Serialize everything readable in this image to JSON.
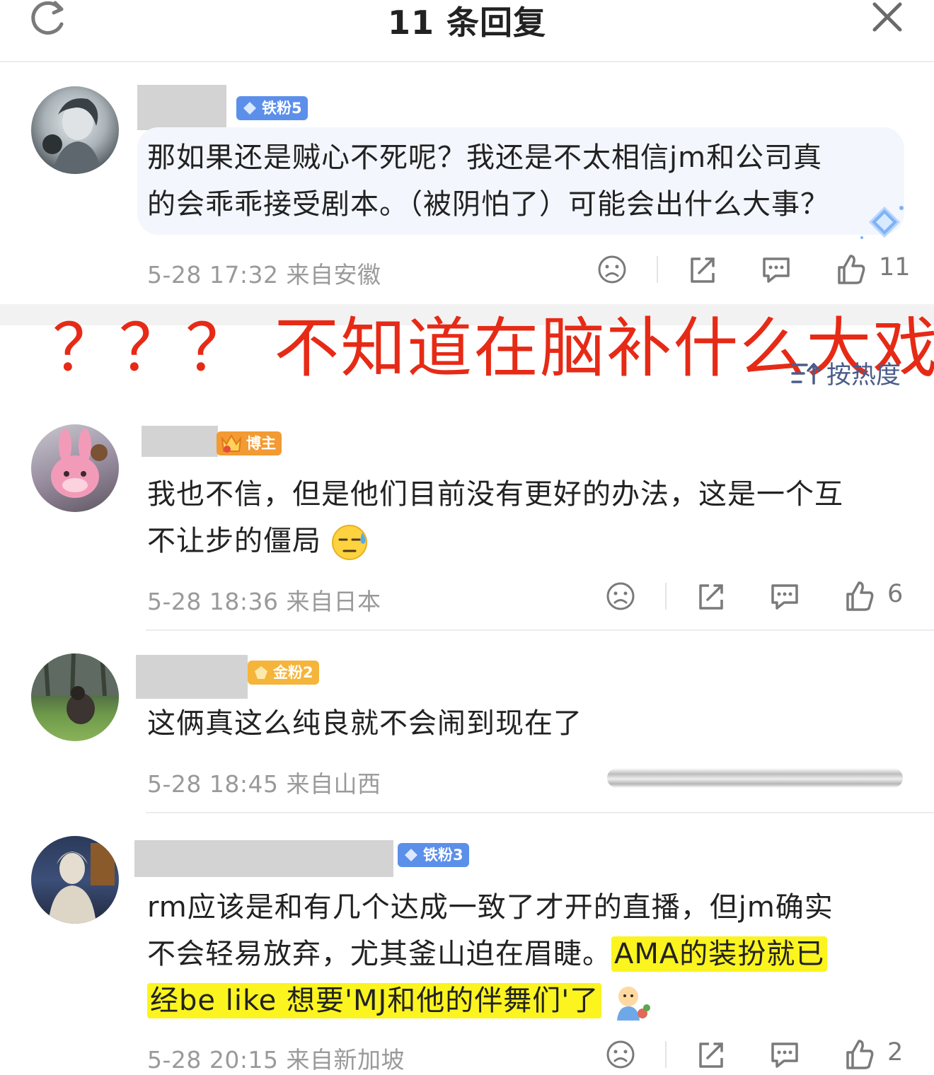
{
  "header": {
    "title": "11 条回复"
  },
  "overlay": {
    "annotation": "？？？ 不知道在脑补什么大戏"
  },
  "sort": {
    "label": "按热度"
  },
  "comments": [
    {
      "badge": "铁粉5",
      "text_line1": "那如果还是贼心不死呢？我还是不太相信jm和公司真",
      "text_line2": "的会乖乖接受剧本。（被阴怕了）可能会出什么大事？",
      "meta": "5-28 17:32  来自安徽",
      "likes": "11"
    },
    {
      "badge": "博主",
      "text_line1": "我也不信，但是他们目前没有更好的办法，这是一个互",
      "text_line2": "不让步的僵局",
      "meta": "5-28 18:36  来自日本",
      "likes": "6"
    },
    {
      "badge": "金粉2",
      "text_line1": "这俩真这么纯良就不会闹到现在了",
      "meta": "5-28 18:45  来自山西"
    },
    {
      "badge": "铁粉3",
      "text_line1": "rm应该是和有几个达成一致了才开的直播，但jm确实",
      "text_line2a": "不会轻易放弃，尤其釜山迫在眉睫。",
      "text_line2b": "AMA的装扮就已",
      "text_line3": "经be like 想要'MJ和他的伴舞们'了",
      "meta": "5-28 20:15  来自新加坡",
      "likes": "2"
    }
  ],
  "colors": {
    "badge_iron": "#5b8fea",
    "badge_gold": "#f5b43a",
    "badge_blogger": "#f39a32",
    "annotation_red": "#e62a16",
    "highlight_yellow": "#fbf41f",
    "meta_gray": "#9a9a9a"
  },
  "icons": [
    "refresh-icon",
    "close-icon",
    "dislike-icon",
    "share-icon",
    "comment-icon",
    "like-icon",
    "sort-icon"
  ]
}
